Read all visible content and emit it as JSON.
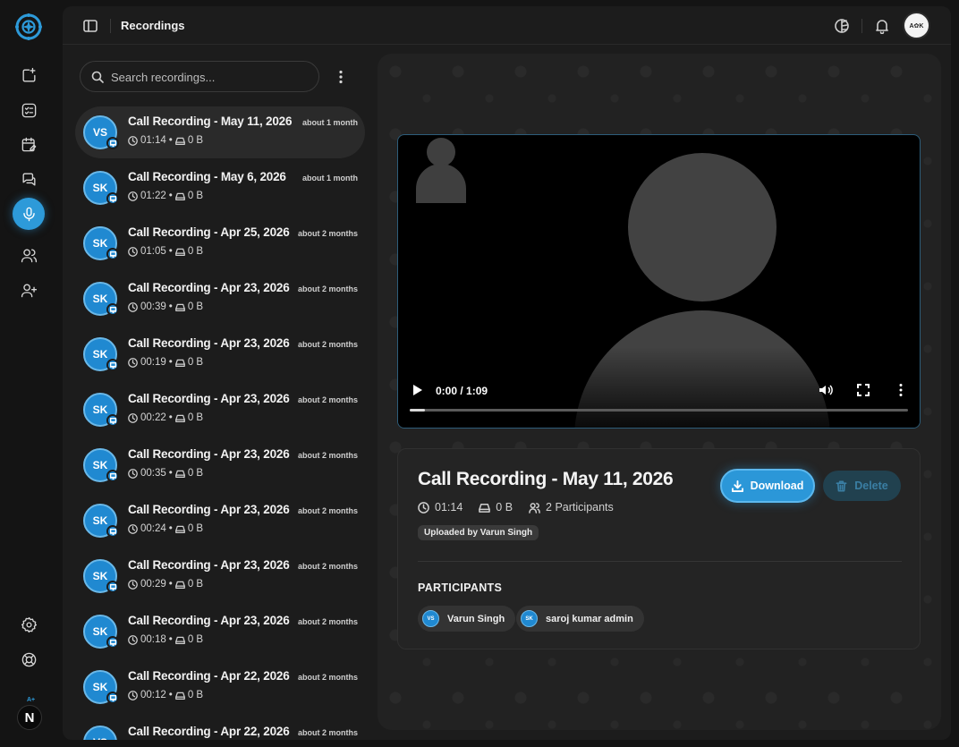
{
  "colors": {
    "accent": "#2d9ad9",
    "background": "#141414",
    "panel": "#1c1c1c"
  },
  "rail": {
    "logo": "brand-logo-icon",
    "items": [
      {
        "name": "add-note-icon"
      },
      {
        "name": "task-list-icon"
      },
      {
        "name": "calendar-edit-icon"
      },
      {
        "name": "chat-bubbles-icon"
      },
      {
        "name": "microphone-icon",
        "active": true
      },
      {
        "name": "users-icon"
      },
      {
        "name": "add-user-icon"
      }
    ],
    "bottom": [
      {
        "name": "settings-icon"
      },
      {
        "name": "help-lifebuoy-icon"
      }
    ],
    "n_badge": "N",
    "ai_label": "A+"
  },
  "topbar": {
    "title": "Recordings",
    "avatar_text": "A✿K"
  },
  "search": {
    "placeholder": "Search recordings..."
  },
  "recordings": [
    {
      "initials": "VS",
      "title": "Call Recording - May 11, 2026",
      "age": "about 1 month",
      "duration": "01:14",
      "size": "0 B",
      "selected": true
    },
    {
      "initials": "SK",
      "title": "Call Recording - May 6, 2026",
      "age": "about 1 month",
      "duration": "01:22",
      "size": "0 B"
    },
    {
      "initials": "SK",
      "title": "Call Recording - Apr 25, 2026",
      "age": "about 2 months",
      "duration": "01:05",
      "size": "0 B"
    },
    {
      "initials": "SK",
      "title": "Call Recording - Apr 23, 2026",
      "age": "about 2 months",
      "duration": "00:39",
      "size": "0 B"
    },
    {
      "initials": "SK",
      "title": "Call Recording - Apr 23, 2026",
      "age": "about 2 months",
      "duration": "00:19",
      "size": "0 B"
    },
    {
      "initials": "SK",
      "title": "Call Recording - Apr 23, 2026",
      "age": "about 2 months",
      "duration": "00:22",
      "size": "0 B"
    },
    {
      "initials": "SK",
      "title": "Call Recording - Apr 23, 2026",
      "age": "about 2 months",
      "duration": "00:35",
      "size": "0 B"
    },
    {
      "initials": "SK",
      "title": "Call Recording - Apr 23, 2026",
      "age": "about 2 months",
      "duration": "00:24",
      "size": "0 B"
    },
    {
      "initials": "SK",
      "title": "Call Recording - Apr 23, 2026",
      "age": "about 2 months",
      "duration": "00:29",
      "size": "0 B"
    },
    {
      "initials": "SK",
      "title": "Call Recording - Apr 23, 2026",
      "age": "about 2 months",
      "duration": "00:18",
      "size": "0 B"
    },
    {
      "initials": "SK",
      "title": "Call Recording - Apr 22, 2026",
      "age": "about 2 months",
      "duration": "00:12",
      "size": "0 B"
    },
    {
      "initials": "VS",
      "title": "Call Recording - Apr 22, 2026",
      "age": "about 2 months",
      "duration": "",
      "size": ""
    }
  ],
  "player": {
    "time": "0:00 / 1:09",
    "progress": 0.03
  },
  "detail": {
    "title": "Call Recording - May 11, 2026",
    "duration": "01:14",
    "size": "0 B",
    "participants_count": "2 Participants",
    "uploaded_by": "Uploaded by Varun Singh",
    "download_label": "Download",
    "delete_label": "Delete",
    "participants_heading": "PARTICIPANTS",
    "participants": [
      {
        "initials": "VS",
        "name": "Varun Singh"
      },
      {
        "initials": "SK",
        "name": "saroj kumar admin"
      }
    ]
  }
}
